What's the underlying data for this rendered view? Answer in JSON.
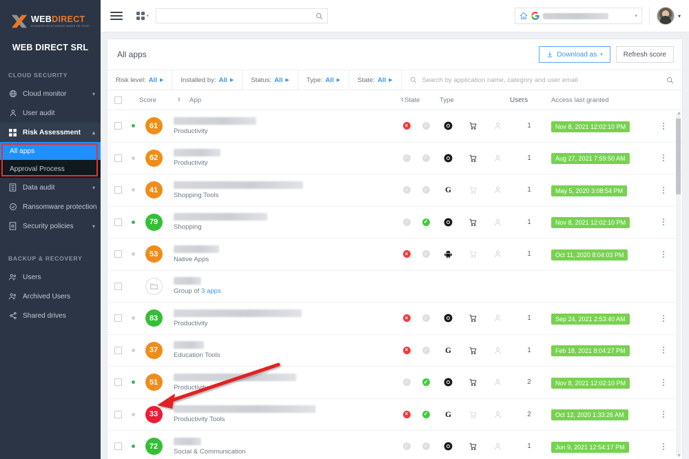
{
  "sidebar": {
    "logo": {
      "web": "WEB",
      "direct": "DIRECT",
      "tagline": "BUSINESS RELATIONSHIP BASED ON TRUST"
    },
    "org_name": "WEB DIRECT SRL",
    "sections": [
      {
        "title": "CLOUD SECURITY",
        "items": [
          {
            "label": "Cloud monitor",
            "icon": "globe-icon",
            "chevron": "down"
          },
          {
            "label": "User audit",
            "icon": "user-icon",
            "chevron": ""
          },
          {
            "label": "Risk Assessment",
            "icon": "grid-icon",
            "chevron": "up",
            "active": true
          },
          {
            "label": "Data audit",
            "icon": "book-icon",
            "chevron": "down"
          },
          {
            "label": "Ransomware protection",
            "icon": "shield-check-icon",
            "chevron": ""
          },
          {
            "label": "Security policies",
            "icon": "policy-icon",
            "chevron": "down"
          }
        ],
        "sub_items": [
          {
            "label": "All apps",
            "selected": true
          },
          {
            "label": "Approval Process",
            "selected": false
          }
        ]
      },
      {
        "title": "BACKUP & RECOVERY",
        "items": [
          {
            "label": "Users",
            "icon": "users-icon",
            "chevron": ""
          },
          {
            "label": "Archived Users",
            "icon": "users-archive-icon",
            "chevron": ""
          },
          {
            "label": "Shared drives",
            "icon": "share-icon",
            "chevron": ""
          }
        ]
      }
    ],
    "highlight_color": "#e8312a"
  },
  "topbar": {
    "menu_icon": "hamburger-icon",
    "apps_grid_icon": "grid-apps-icon",
    "search": {
      "value": "",
      "placeholder": ""
    },
    "search_icon": "search-icon",
    "domain_selector": {
      "home_icon": "home-icon",
      "google_icon": "google-icon",
      "value": ""
    },
    "avatar": "user-avatar",
    "avatar_caret": "chevron-down-icon"
  },
  "page": {
    "title": "All apps",
    "download_button": {
      "label": "Download as",
      "icon": "download-icon",
      "caret": "chevron-down-icon"
    },
    "refresh_button": {
      "label": "Refresh score"
    }
  },
  "filters": [
    {
      "name": "Risk level:",
      "value": "All"
    },
    {
      "name": "Installed by:",
      "value": "All"
    },
    {
      "name": "Status:",
      "value": "All"
    },
    {
      "name": "Type:",
      "value": "All"
    },
    {
      "name": "State:",
      "value": "All"
    }
  ],
  "filter_search": {
    "value": "",
    "placeholder": "Search by application name, category and user email",
    "icon": "search-icon"
  },
  "table": {
    "columns": [
      "",
      "",
      "Score",
      "App",
      "State",
      "Type",
      "Users",
      "Access last granted",
      ""
    ],
    "headers": {
      "score": "Score",
      "app": "App",
      "state": "State",
      "type": "Type",
      "users": "Users",
      "access": "Access last granted"
    },
    "rows": [
      {
        "dot": "green",
        "score": "61",
        "score_color": "orange",
        "name_width": 120,
        "category": "Productivity",
        "state": [
          "red-x",
          "grey"
        ],
        "types": [
          "chrome",
          "marketplace",
          "user"
        ],
        "users": "1",
        "access": "Nov 8, 2021 12:02:10 PM"
      },
      {
        "dot": "grey",
        "score": "62",
        "score_color": "orange",
        "name_width": 68,
        "category": "Productivity",
        "state": [
          "grey",
          "grey"
        ],
        "types": [
          "chrome",
          "marketplace",
          "user"
        ],
        "users": "1",
        "access": "Aug 27, 2021 7:59:50 AM"
      },
      {
        "dot": "grey",
        "score": "41",
        "score_color": "orange",
        "name_width": 188,
        "category": "Shopping Tools",
        "state": [
          "grey",
          "grey"
        ],
        "types": [
          "google",
          "marketplace-off",
          "user"
        ],
        "users": "1",
        "access": "May 5, 2020 3:08:54 PM"
      },
      {
        "dot": "green",
        "score": "79",
        "score_color": "green",
        "name_width": 136,
        "category": "Shopping",
        "state": [
          "grey",
          "green-check"
        ],
        "types": [
          "chrome",
          "marketplace",
          "user"
        ],
        "users": "1",
        "access": "Nov 8, 2021 12:02:10 PM"
      },
      {
        "dot": "grey",
        "score": "53",
        "score_color": "orange",
        "name_width": 66,
        "category": "Native Apps",
        "state": [
          "red-x",
          "grey"
        ],
        "types": [
          "android",
          "marketplace-off",
          "user"
        ],
        "users": "1",
        "access": "Oct 11, 2020 8:04:03 PM"
      },
      {
        "dot": "none",
        "score": "",
        "score_color": "folder",
        "name_width": 40,
        "category": "Group of 3 apps",
        "category_link": "3 apps",
        "state": [],
        "types": [],
        "users": "",
        "access": ""
      },
      {
        "dot": "grey",
        "score": "83",
        "score_color": "green",
        "name_width": 186,
        "category": "Productivity",
        "state": [
          "red-x",
          "grey"
        ],
        "types": [
          "chrome",
          "marketplace",
          "user"
        ],
        "users": "1",
        "access": "Sep 24, 2021 2:53:40 AM"
      },
      {
        "dot": "grey",
        "score": "37",
        "score_color": "orange",
        "name_width": 44,
        "category": "Education Tools",
        "state": [
          "red-x",
          "grey"
        ],
        "types": [
          "google",
          "marketplace",
          "user"
        ],
        "users": "1",
        "access": "Feb 18, 2021 8:04:27 PM"
      },
      {
        "dot": "green",
        "score": "51",
        "score_color": "orange",
        "name_width": 178,
        "category": "Productivity",
        "state": [
          "grey",
          "green-check"
        ],
        "types": [
          "chrome",
          "marketplace",
          "user"
        ],
        "users": "2",
        "access": "Nov 8, 2021 12:02:10 PM"
      },
      {
        "dot": "grey",
        "score": "33",
        "score_color": "red",
        "name_width": 206,
        "category": "Productivity Tools",
        "state": [
          "red-x",
          "green-check"
        ],
        "types": [
          "google",
          "marketplace-off",
          "user"
        ],
        "users": "2",
        "access": "Oct 12, 2020 1:33:26 AM"
      },
      {
        "dot": "green",
        "score": "72",
        "score_color": "green",
        "name_width": 40,
        "category": "Social & Communication",
        "state": [
          "grey",
          "grey"
        ],
        "types": [
          "chrome",
          "marketplace",
          "user"
        ],
        "users": "1",
        "access": "Jun 9, 2021 12:54:17 PM"
      }
    ]
  },
  "annotation": {
    "arrow_color": "#e02020",
    "points_to": "score-badge-33"
  }
}
